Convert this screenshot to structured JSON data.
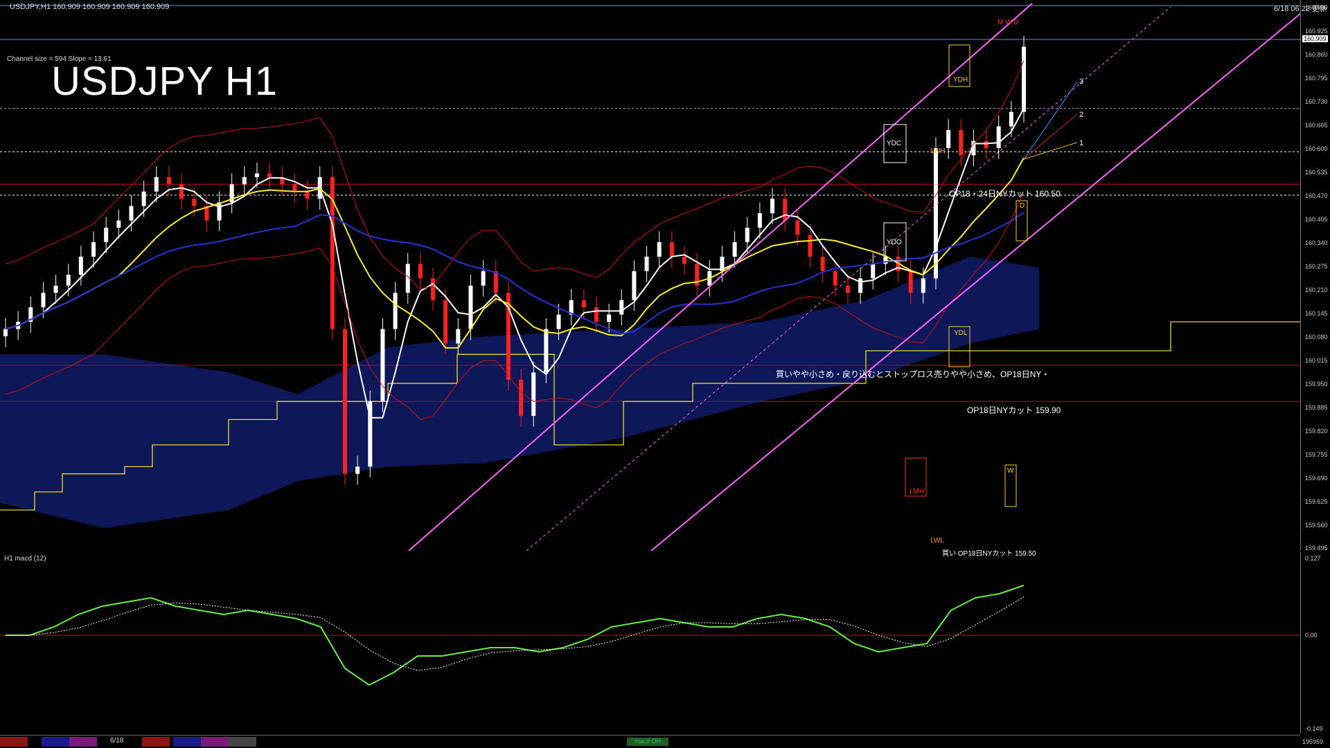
{
  "header": {
    "symbol_info": "USDJPY,H1  160.909 160.909 160.909 160.909",
    "title": "USDJPY H1",
    "channel_info": "Channel size = 594 Slope = 13.61",
    "datetime": "6/18 06:22 更新"
  },
  "price_scale": [
    "160.990",
    "160.925",
    "160.860",
    "160.795",
    "160.730",
    "160.665",
    "160.600",
    "160.535",
    "160.470",
    "160.405",
    "160.340",
    "160.275",
    "160.210",
    "160.145",
    "160.080",
    "160.015",
    "159.950",
    "159.885",
    "159.820",
    "159.755",
    "159.690",
    "159.625",
    "159.560",
    "159.495"
  ],
  "current_price": "160.909",
  "annotations": {
    "cut_upper": "OP18・24日NYカット 160.50",
    "cut_lower": "OP18日NYカット 159.90",
    "comment": "買いやや小さめ・戻り込むとストップロス売りやや小さめ、OP18日NY・",
    "cut_bottom": "買い OP18日NYカット 159.50"
  },
  "box_labels": {
    "ydh": "YDH",
    "ydc": "YDC",
    "ydo": "YDO",
    "ydl": "YDL",
    "lwh": "LWH",
    "lwl": "LWL",
    "lmh": "LMH",
    "w": "W",
    "d": "D",
    "mwd": "M W D"
  },
  "channel_labels": [
    "3",
    "2",
    "1"
  ],
  "macd": {
    "label": "H1  macd (12)",
    "scale": [
      "0.127",
      "0.00",
      "-0.149"
    ],
    "tag": "macd OH"
  },
  "footer": {
    "date": "6/18",
    "number": "195959"
  },
  "colors": {
    "bull": "#ffffff",
    "bear": "#ff2020",
    "cloud": "#1a2aa0",
    "ma_white": "#ffffff",
    "ma_yellow": "#ffee22",
    "ma_blue": "#2233dd",
    "channel": "#ff66ff",
    "bb": "#cc1111",
    "macd_up": "#66ee44",
    "macd_down": "#ff88cc"
  },
  "chart_data": {
    "type": "candlestick",
    "title": "USDJPY H1",
    "ylim": [
      159.495,
      160.99
    ],
    "candles_close": [
      160.1,
      160.12,
      160.16,
      160.2,
      160.22,
      160.25,
      160.3,
      160.34,
      160.38,
      160.4,
      160.44,
      160.48,
      160.52,
      160.5,
      160.46,
      160.44,
      160.4,
      160.45,
      160.5,
      160.52,
      160.53,
      160.52,
      160.5,
      160.48,
      160.46,
      160.52,
      160.1,
      159.7,
      159.72,
      159.9,
      160.1,
      160.2,
      160.28,
      160.24,
      160.18,
      160.06,
      160.1,
      160.22,
      160.26,
      160.2,
      159.96,
      159.86,
      159.98,
      160.1,
      160.14,
      160.18,
      160.16,
      160.12,
      160.14,
      160.18,
      160.26,
      160.3,
      160.34,
      160.3,
      160.28,
      160.22,
      160.26,
      160.3,
      160.34,
      160.38,
      160.42,
      160.46,
      160.4,
      160.36,
      160.3,
      160.26,
      160.22,
      160.2,
      160.24,
      160.28,
      160.3,
      160.26,
      160.2,
      160.24,
      160.6,
      160.65,
      160.58,
      160.62,
      160.6,
      160.66,
      160.7,
      160.88
    ]
  }
}
